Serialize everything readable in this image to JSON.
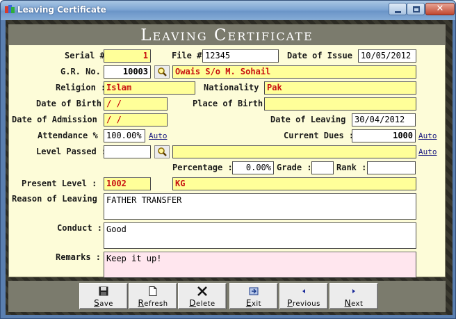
{
  "window": {
    "title": "Leaving Certificate"
  },
  "header": {
    "title": "Leaving Certificate"
  },
  "form": {
    "serial_label": "Serial #",
    "serial_value": "1",
    "file_label": "File #",
    "file_value": "12345",
    "issue_label": "Date of Issue :",
    "issue_value": "10/05/2012",
    "gr_label": "G.R. No. :",
    "gr_value": "10003",
    "student_name": "Owais S/o M. Sohail",
    "religion_label": "Religion :",
    "religion_value": "Islam",
    "nationality_label": "Nationality :",
    "nationality_value": "Pak",
    "dob_label": "Date of Birth :",
    "dob_value": " / /",
    "pob_label": "Place of Birth :",
    "pob_value": "",
    "doa_label": "Date of Admission :",
    "doa_value": " / /",
    "dol_label": "Date of Leaving :",
    "dol_value": "30/04/2012",
    "attendance_label": "Attendance %",
    "attendance_value": "100.00%",
    "attendance_auto": "Auto",
    "dues_label": "Current Dues :",
    "dues_value": "1000",
    "dues_auto": "Auto",
    "level_passed_label": "Level Passed :",
    "level_passed_code": "",
    "level_passed_name": "",
    "level_passed_auto": "Auto",
    "percentage_label": "Percentage :",
    "percentage_value": "0.00%",
    "grade_label": "Grade :",
    "grade_value": "",
    "rank_label": "Rank :",
    "rank_value": "",
    "present_level_label": "Present Level :",
    "present_level_code": "1002",
    "present_level_name": "KG",
    "reason_label": "Reason of Leaving :",
    "reason_value": "FATHER TRANSFER",
    "conduct_label": "Conduct :",
    "conduct_value": "Good",
    "remarks_label": "Remarks :",
    "remarks_value": "Keep it up!"
  },
  "toolbar": {
    "save_label": "Save",
    "refresh_label": "Refresh",
    "delete_label": "Delete",
    "exit_label": "Exit",
    "previous_label": "Previous",
    "next_label": "Next"
  },
  "icons": {
    "search": "magnifier-icon",
    "save": "floppy-disk-icon",
    "refresh": "blank-page-icon",
    "delete": "x-cross-icon",
    "exit": "exit-door-icon",
    "previous": "triangle-left-icon",
    "next": "triangle-right-icon"
  },
  "colors": {
    "input_yellow": "#ffff99",
    "panel_bg": "#fdfcd8",
    "header_bg": "#7b7b6d",
    "red_text": "#c81010"
  }
}
